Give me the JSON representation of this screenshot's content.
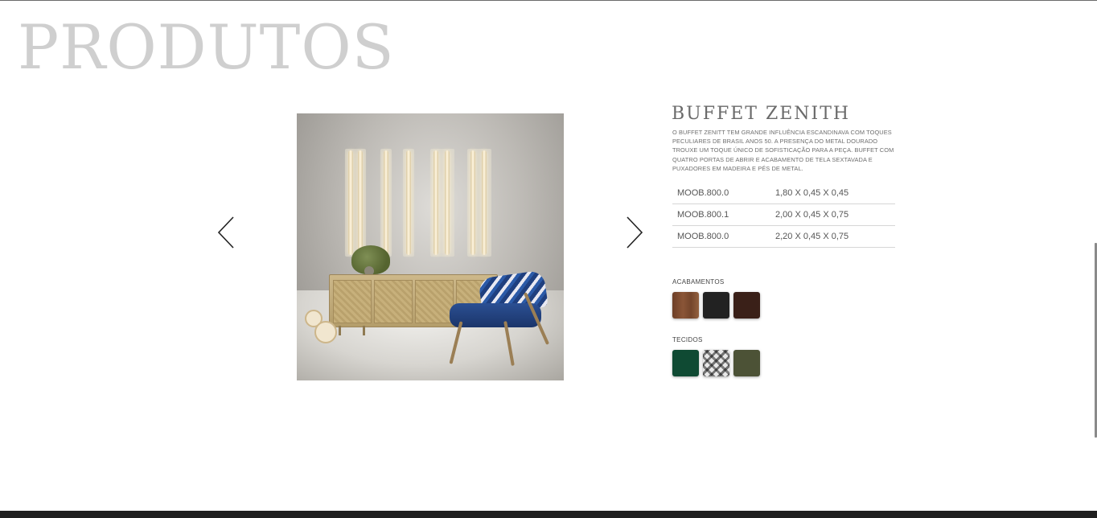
{
  "page": {
    "title": "PRODUTOS"
  },
  "carousel": {
    "prev_icon": "chevron-left-icon",
    "next_icon": "chevron-right-icon",
    "image_alt": "Buffet Zenith"
  },
  "product": {
    "name": "BUFFET ZENITH",
    "description": "O BUFFET ZENITT TEM GRANDE INFLUÊNCIA ESCANDINAVA COM TOQUES PECULIARES DE BRASIL ANOS 50. A PRESENÇA DO METAL DOURADO TROUXE UM TOQUE ÚNICO DE SOFISTICAÇÃO PARA A PEÇA. BUFFET COM QUATRO PORTAS DE ABRIR E ACABAMENTO DE TELA SEXTAVADA E PUXADORES EM MADEIRA E PÉS DE METAL.",
    "specs": [
      {
        "code": "MOOB.800.0",
        "dimensions": "1,80 X 0,45 X 0,45"
      },
      {
        "code": "MOOB.800.1",
        "dimensions": "2,00 X 0,45 X 0,75"
      },
      {
        "code": "MOOB.800.0",
        "dimensions": "2,20 X 0,45 X 0,75"
      }
    ],
    "finishes": {
      "label": "ACABAMENTOS",
      "swatches": [
        "#7a4a30",
        "#222222",
        "#3a2018"
      ]
    },
    "fabrics": {
      "label": "TECIDOS",
      "swatches": [
        "#0f4a33",
        "pattern",
        "#4c5236"
      ]
    }
  }
}
